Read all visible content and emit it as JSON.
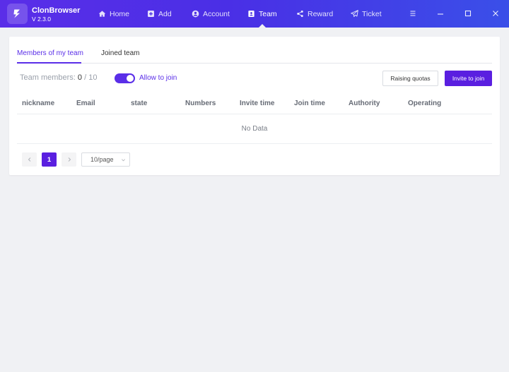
{
  "app": {
    "name": "ClonBrowser",
    "version": "V 2.3.0"
  },
  "nav": [
    {
      "label": "Home",
      "icon": "home-icon"
    },
    {
      "label": "Add",
      "icon": "add-icon"
    },
    {
      "label": "Account",
      "icon": "account-icon"
    },
    {
      "label": "Team",
      "icon": "team-icon",
      "active": true
    },
    {
      "label": "Reward",
      "icon": "share-icon"
    },
    {
      "label": "Ticket",
      "icon": "send-icon"
    }
  ],
  "tabs": [
    {
      "label": "Members of my team",
      "active": true
    },
    {
      "label": "Joined team"
    }
  ],
  "toolbar": {
    "members_label": "Team members:",
    "members_current": "0",
    "members_sep": " / ",
    "members_max": "10",
    "allow_join_label": "Allow to join",
    "allow_join_on": true,
    "raising_quotas": "Raising quotas",
    "invite_to_join": "Invite to join"
  },
  "table": {
    "columns": [
      "nickname",
      "Email",
      "state",
      "Numbers",
      "Invite time",
      "Join time",
      "Authority",
      "Operating"
    ],
    "empty_text": "No Data"
  },
  "pagination": {
    "current_page": "1",
    "page_size": "10/page"
  },
  "colors": {
    "accent": "#5a2ee8",
    "button": "#5a1fe0",
    "background": "#f0f1f4"
  }
}
